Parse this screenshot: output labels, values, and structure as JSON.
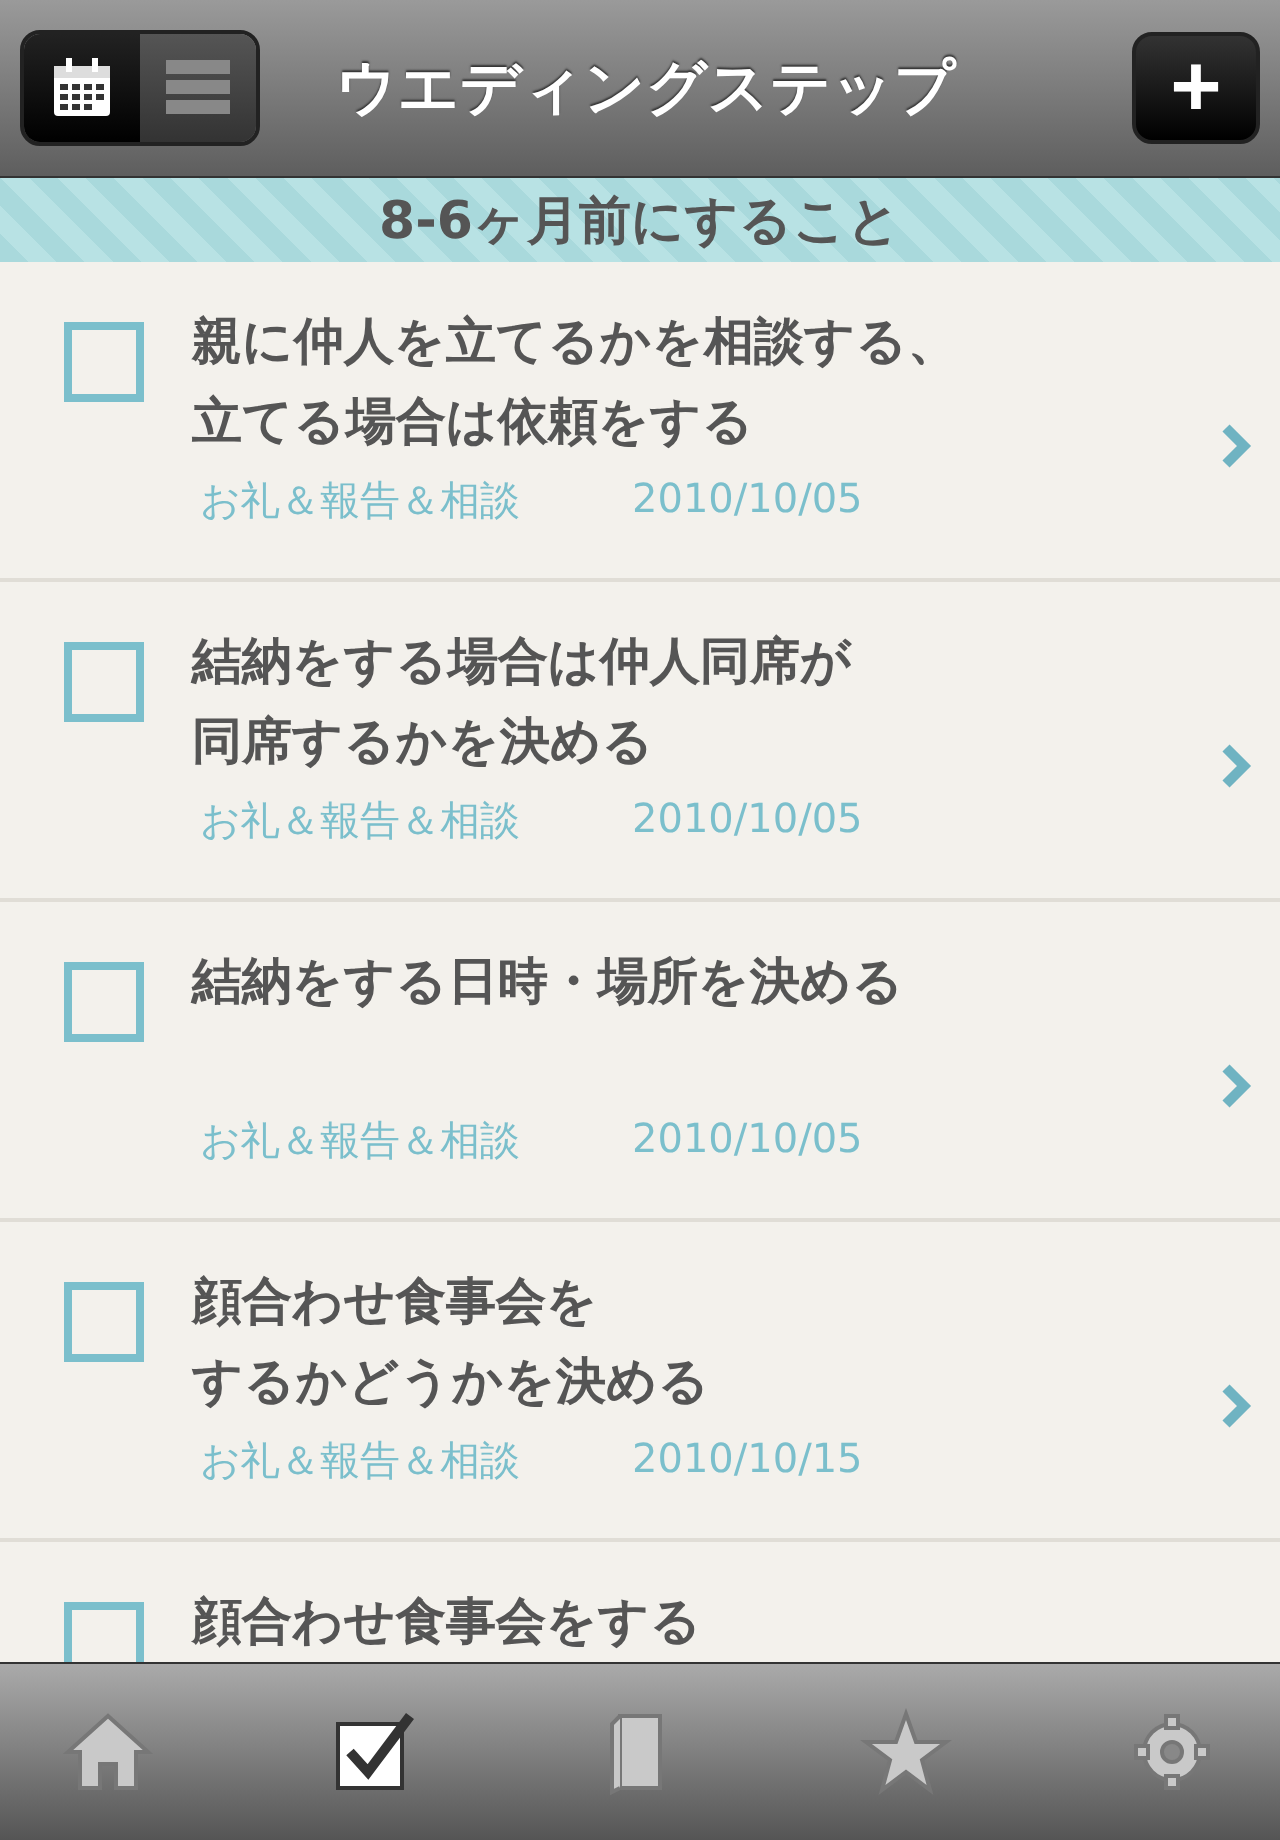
{
  "header": {
    "segments": [
      {
        "kind": "calendar",
        "selected": true
      },
      {
        "kind": "list",
        "selected": false
      }
    ],
    "title": "ウエディングステップ",
    "add_button": "+"
  },
  "section": {
    "title": "8-6ヶ月前にすること"
  },
  "tasks": [
    {
      "title_lines": [
        "親に仲人を立てるかを相談する、",
        "立てる場合は依頼をする"
      ],
      "checked": false,
      "category": "お礼＆報告＆相談",
      "date": "2010/10/05"
    },
    {
      "title_lines": [
        "結納をする場合は仲人同席が",
        "同席するかを決める"
      ],
      "checked": false,
      "category": "お礼＆報告＆相談",
      "date": "2010/10/05"
    },
    {
      "title_lines": [
        "結納をする日時・場所を決める"
      ],
      "checked": false,
      "category": "お礼＆報告＆相談",
      "date": "2010/10/05"
    },
    {
      "title_lines": [
        "顔合わせ食事会を",
        "するかどうかを決める"
      ],
      "checked": false,
      "category": "お礼＆報告＆相談",
      "date": "2010/10/15"
    },
    {
      "title_lines": [
        "顔合わせ食事会をする"
      ],
      "checked": false
    }
  ],
  "tab_bar": [
    {
      "kind": "home",
      "selected": false
    },
    {
      "kind": "check",
      "selected": true
    },
    {
      "kind": "book",
      "selected": false
    },
    {
      "kind": "star",
      "selected": false
    },
    {
      "kind": "gear",
      "selected": false
    }
  ]
}
